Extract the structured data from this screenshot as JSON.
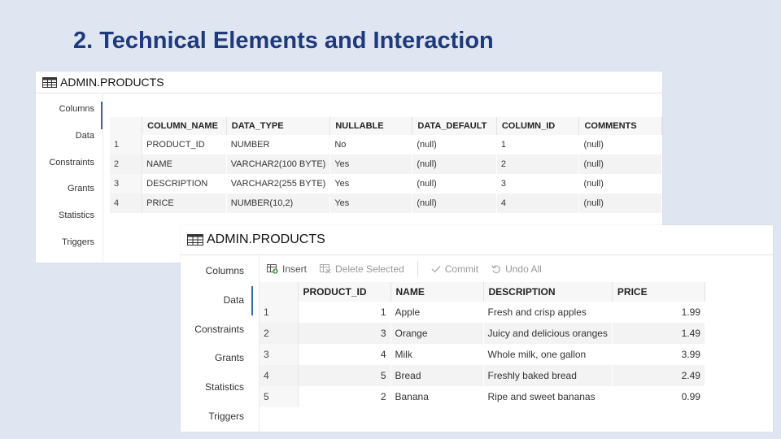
{
  "slide": {
    "title": "2. Technical Elements and Interaction"
  },
  "colors": {
    "title": "#1f3a7a",
    "accent": "#2a6cb0",
    "background": "#dfe6f1",
    "insert_icon_green": "#3a9b46"
  },
  "panel1": {
    "title": "ADMIN.PRODUCTS",
    "icon": "table-grid-icon",
    "sidebar": [
      "Columns",
      "Data",
      "Constraints",
      "Grants",
      "Statistics",
      "Triggers"
    ],
    "active_tab": "Columns",
    "columns": [
      "COLUMN_NAME",
      "DATA_TYPE",
      "NULLABLE",
      "DATA_DEFAULT",
      "COLUMN_ID",
      "COMMENTS"
    ],
    "rows": [
      {
        "num": "1",
        "cells": [
          "PRODUCT_ID",
          "NUMBER",
          "No",
          "(null)",
          "1",
          "(null)"
        ]
      },
      {
        "num": "2",
        "cells": [
          "NAME",
          "VARCHAR2(100 BYTE)",
          "Yes",
          "(null)",
          "2",
          "(null)"
        ]
      },
      {
        "num": "3",
        "cells": [
          "DESCRIPTION",
          "VARCHAR2(255 BYTE)",
          "Yes",
          "(null)",
          "3",
          "(null)"
        ]
      },
      {
        "num": "4",
        "cells": [
          "PRICE",
          "NUMBER(10,2)",
          "Yes",
          "(null)",
          "4",
          "(null)"
        ]
      }
    ]
  },
  "panel2": {
    "title": "ADMIN.PRODUCTS",
    "icon": "table-grid-icon",
    "sidebar": [
      "Columns",
      "Data",
      "Constraints",
      "Grants",
      "Statistics",
      "Triggers"
    ],
    "active_tab": "Data",
    "toolbar": {
      "insert": "Insert",
      "delete": "Delete Selected",
      "commit": "Commit",
      "undo": "Undo All"
    },
    "columns": [
      "PRODUCT_ID",
      "NAME",
      "DESCRIPTION",
      "PRICE"
    ],
    "rows": [
      {
        "num": "1",
        "cells": [
          "1",
          "Apple",
          "Fresh and crisp apples",
          "1.99"
        ]
      },
      {
        "num": "2",
        "cells": [
          "3",
          "Orange",
          "Juicy and delicious oranges",
          "1.49"
        ]
      },
      {
        "num": "3",
        "cells": [
          "4",
          "Milk",
          "Whole milk, one gallon",
          "3.99"
        ]
      },
      {
        "num": "4",
        "cells": [
          "5",
          "Bread",
          "Freshly baked bread",
          "2.49"
        ]
      },
      {
        "num": "5",
        "cells": [
          "2",
          "Banana",
          "Ripe and sweet bananas",
          "0.99"
        ]
      }
    ]
  }
}
